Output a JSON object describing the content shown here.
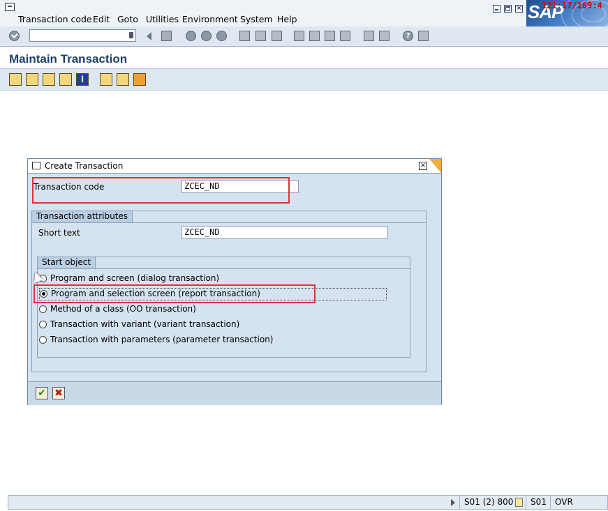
{
  "menu": {
    "items": [
      "Transaction code",
      "Edit",
      "Goto",
      "Utilities",
      "Environment",
      "System",
      "Help"
    ]
  },
  "branding": {
    "logo": "SAP",
    "clock": "121:17/169:4"
  },
  "toolbar": {
    "command_field_value": "",
    "icons": [
      "enter-icon",
      "save-icon",
      "back-icon",
      "exit-icon",
      "cancel-icon",
      "print-icon",
      "find-icon",
      "find-next-icon",
      "first-page-icon",
      "prev-page-icon",
      "next-page-icon",
      "last-page-icon",
      "new-session-icon",
      "shortcut-icon",
      "help-icon",
      "layout-icon"
    ]
  },
  "page": {
    "title": "Maintain Transaction"
  },
  "app_toolbar": {
    "icons": [
      "display-object-list-icon",
      "display-navigation-window-icon",
      "other-object-icon",
      "where-used-icon",
      "info-icon",
      "delete-icon",
      "copy-icon",
      "test-icon"
    ]
  },
  "dialog": {
    "title": "Create Transaction",
    "transaction_code_label": "Transaction code",
    "transaction_code_value": "ZCEC_ND",
    "attributes_group_title": "Transaction attributes",
    "short_text_label": "Short text",
    "short_text_value": "ZCEC_ND",
    "start_object_title": "Start object",
    "options": [
      {
        "label": "Program and screen (dialog transaction)",
        "selected": false
      },
      {
        "label": "Program and selection screen (report transaction)",
        "selected": true
      },
      {
        "label": "Method of a class (OO transaction)",
        "selected": false
      },
      {
        "label": "Transaction with variant (variant transaction)",
        "selected": false
      },
      {
        "label": "Transaction with parameters (parameter transaction)",
        "selected": false
      }
    ],
    "footer_icons": [
      "continue-icon",
      "cancel-icon"
    ]
  },
  "status": {
    "session": "S01 (2) 800",
    "server": "S01",
    "mode": "OVR"
  },
  "colors": {
    "highlight": "#e0323a",
    "dialog_bg": "#d5e2ef",
    "title_color": "#1f3f6b"
  }
}
